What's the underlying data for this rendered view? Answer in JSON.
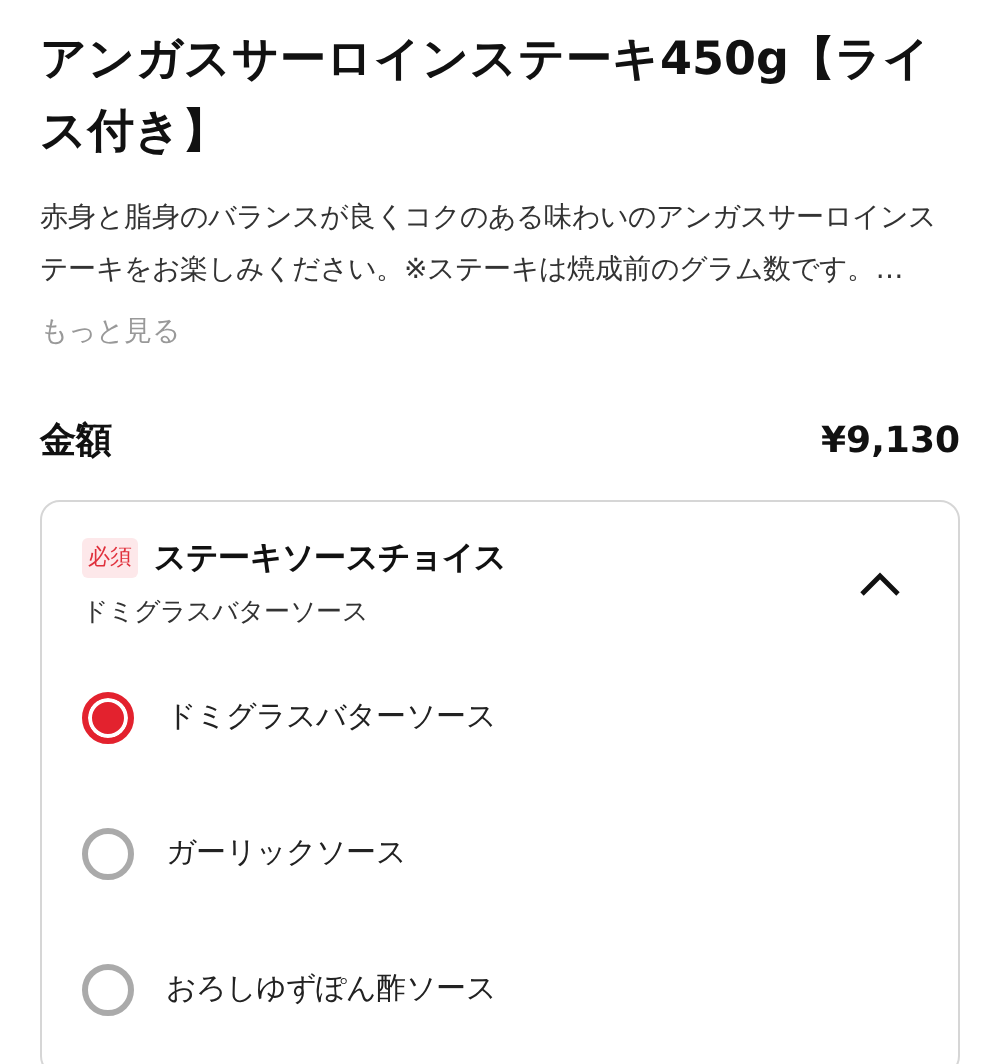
{
  "product": {
    "title": "アンガスサーロインステーキ450g【ライス付き】",
    "description": "赤身と脂身のバランスが良くコクのある味わいのアンガスサーロインステーキをお楽しみください。※ステーキは焼成前のグラム数です。…",
    "more_link": "もっと見る"
  },
  "price": {
    "label": "金額",
    "value": "¥9,130"
  },
  "option_group": {
    "badge": "必須",
    "title": "ステーキソースチョイス",
    "summary": "ドミグラスバターソース",
    "expanded": true,
    "options": [
      {
        "label": "ドミグラスバターソース",
        "selected": true
      },
      {
        "label": "ガーリックソース",
        "selected": false
      },
      {
        "label": "おろしゆずぽん酢ソース",
        "selected": false
      }
    ]
  }
}
